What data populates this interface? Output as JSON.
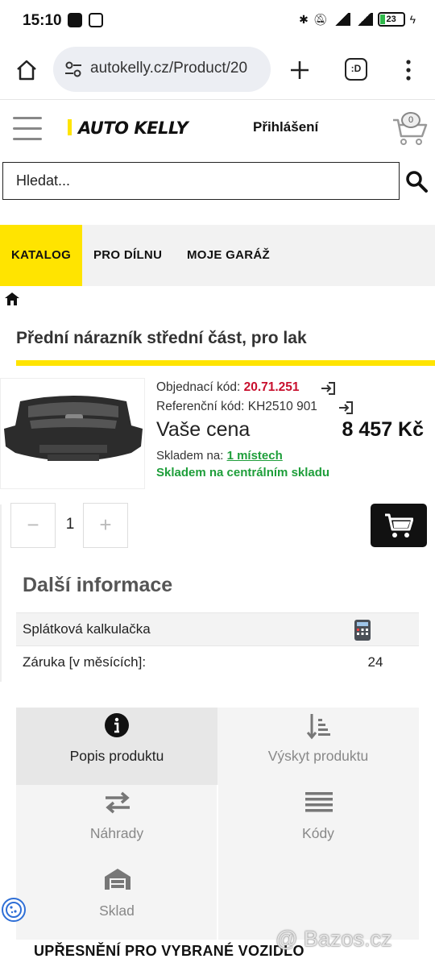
{
  "status_bar": {
    "time": "15:10",
    "battery": "23"
  },
  "browser": {
    "url": "autokelly.cz/Product/20",
    "tabs_label": ":D"
  },
  "header": {
    "logo": "AUTO KELLY",
    "login": "Přihlášení",
    "cart_count": "0"
  },
  "search": {
    "placeholder": "Hledat..."
  },
  "nav": {
    "items": [
      "KATALOG",
      "PRO DÍLNU",
      "MOJE GARÁŽ"
    ]
  },
  "product": {
    "title": "Přední nárazník střední část, pro lak",
    "order_code_label": "Objednací kód:",
    "order_code": "20.71.251",
    "ref_code_label": "Referenční kód:",
    "ref_code": "KH2510 901",
    "price_label": "Vaše cena",
    "price": "8 457 Kč",
    "stock_label": "Skladem na:",
    "stock_places": "1 místech",
    "central_stock": "Skladem na centrálním skladu",
    "quantity": "1"
  },
  "info": {
    "title": "Další informace",
    "rows": [
      {
        "label": "Splátková kalkulačka",
        "value": ""
      },
      {
        "label": "Záruka [v měsících]:",
        "value": "24"
      }
    ]
  },
  "product_tabs": [
    "Popis produktu",
    "Výskyt produktu",
    "Náhrady",
    "Kódy",
    "Sklad"
  ],
  "section": {
    "title": "UPŘESNĚNÍ PRO VYBRANÉ VOZIDLO"
  },
  "watermark": "@ Bazos.cz",
  "colors": {
    "brand_yellow": "#ffe400",
    "price_red": "#c8102e",
    "stock_green": "#1e9e3a"
  }
}
